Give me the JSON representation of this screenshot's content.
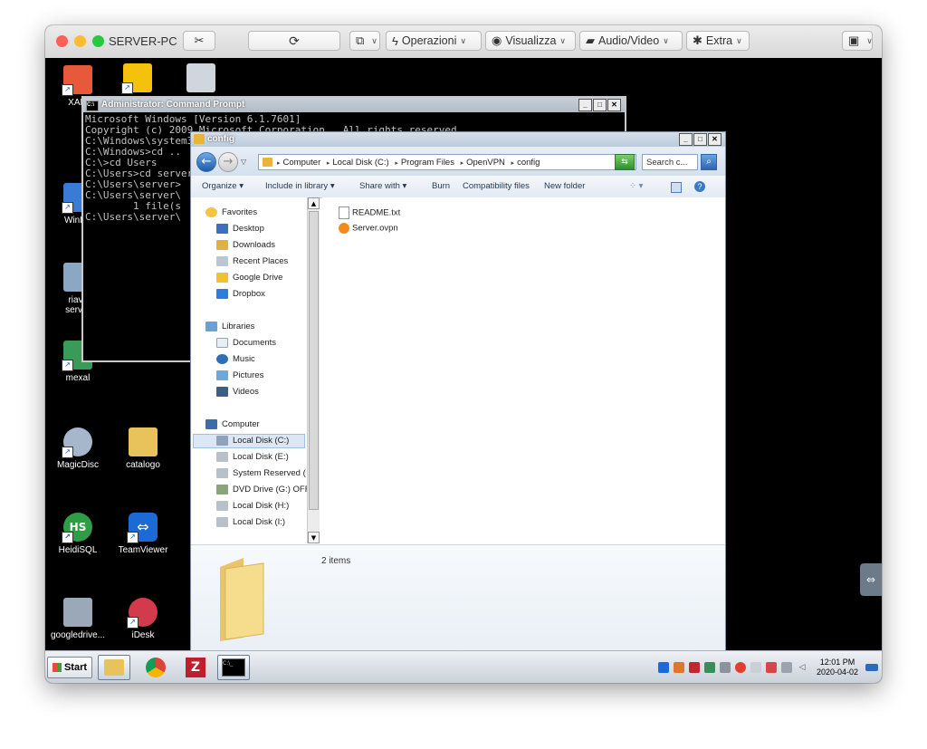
{
  "mac_window": {
    "title": "SERVER-PC",
    "toolbar": {
      "refresh_icon": "refresh-icon",
      "layers_icon": "layers-icon",
      "operazioni": "Operazioni",
      "visualizza": "Visualizza",
      "audio_video": "Audio/Video",
      "extra": "Extra",
      "dropdown_chevron": "∨"
    }
  },
  "desktop_icons": [
    {
      "label": "XAM",
      "icon": "xampp-icon",
      "color": "#e8583b"
    },
    {
      "label": "",
      "icon": "google-drive-icon",
      "color": "#f4c20d"
    },
    {
      "label": "",
      "icon": "recycle-bin-icon",
      "color": "#cfd6de"
    },
    {
      "label": "WinDir",
      "icon": "windirstat-icon",
      "color": "#3a7bd5"
    },
    {
      "label": "riavv",
      "label2": "server",
      "icon": "restart-icon",
      "color": "#8aa7c4"
    },
    {
      "label": "mexal",
      "icon": "mexal-icon",
      "color": "#3a9a57"
    },
    {
      "label": "MagicDisc",
      "icon": "magicdisc-icon",
      "color": "#a6b7cc"
    },
    {
      "label": "catalogo",
      "icon": "folder-icon",
      "color": "#e8c25a"
    },
    {
      "label": "HeidiSQL",
      "icon": "heidisql-icon",
      "color": "#2f9d46"
    },
    {
      "label": "TeamViewer",
      "icon": "teamviewer-icon",
      "color": "#1b6ad6"
    },
    {
      "label": "googledrive...",
      "icon": "googledrive-sync-icon",
      "color": "#9aa8b8"
    },
    {
      "label": "iDesk",
      "icon": "idesk-icon",
      "color": "#d33a4b"
    }
  ],
  "cmd_window": {
    "title": "Administrator: Command Prompt",
    "lines": [
      "Microsoft Windows [Version 6.1.7601]",
      "Copyright (c) 2009 Microsoft Corporation.  All rights reserved.",
      "",
      "C:\\Windows\\system32>cd ..",
      "",
      "C:\\Windows>cd ..",
      "",
      "C:\\>cd Users",
      "",
      "C:\\Users>cd server",
      "",
      "C:\\Users\\server>",
      "",
      "C:\\Users\\server\\",
      "        1 file(s",
      "",
      "C:\\Users\\server\\"
    ]
  },
  "explorer": {
    "title": "config",
    "breadcrumbs": [
      "Computer",
      "Local Disk (C:)",
      "Program Files",
      "OpenVPN",
      "config"
    ],
    "search_placeholder": "Search c...",
    "command_bar": {
      "organize": "Organize",
      "include_in_library": "Include in library",
      "share_with": "Share with",
      "burn": "Burn",
      "compatibility_files": "Compatibility files",
      "new_folder": "New folder"
    },
    "nav": {
      "favorites": "Favorites",
      "desktop": "Desktop",
      "downloads": "Downloads",
      "recent_places": "Recent Places",
      "google_drive": "Google Drive",
      "dropbox": "Dropbox",
      "libraries": "Libraries",
      "documents": "Documents",
      "music": "Music",
      "pictures": "Pictures",
      "videos": "Videos",
      "computer": "Computer",
      "disk_c": "Local Disk (C:)",
      "disk_e": "Local Disk (E:)",
      "system_reserved": "System Reserved (",
      "dvd_drive": "DVD Drive (G:) OFF",
      "disk_h": "Local Disk (H:)",
      "disk_i": "Local Disk (I:)"
    },
    "files": [
      {
        "name": "README.txt",
        "icon": "text-file-icon"
      },
      {
        "name": "Server.ovpn",
        "icon": "openvpn-file-icon"
      }
    ],
    "details": {
      "count": "2 items"
    }
  },
  "taskbar": {
    "start": "Start",
    "apps": [
      {
        "icon": "explorer-taskbar-icon"
      },
      {
        "icon": "chrome-icon"
      },
      {
        "icon": "filezilla-icon"
      },
      {
        "icon": "cmd-taskbar-icon"
      }
    ],
    "clock_time": "12:01 PM",
    "clock_date": "2020-04-02"
  },
  "colors": {
    "mac_red": "#ff5f57",
    "mac_yellow": "#febc2e",
    "mac_green": "#28c840",
    "desktop_bg": "#000000",
    "accent_blue": "#2c64b2"
  }
}
